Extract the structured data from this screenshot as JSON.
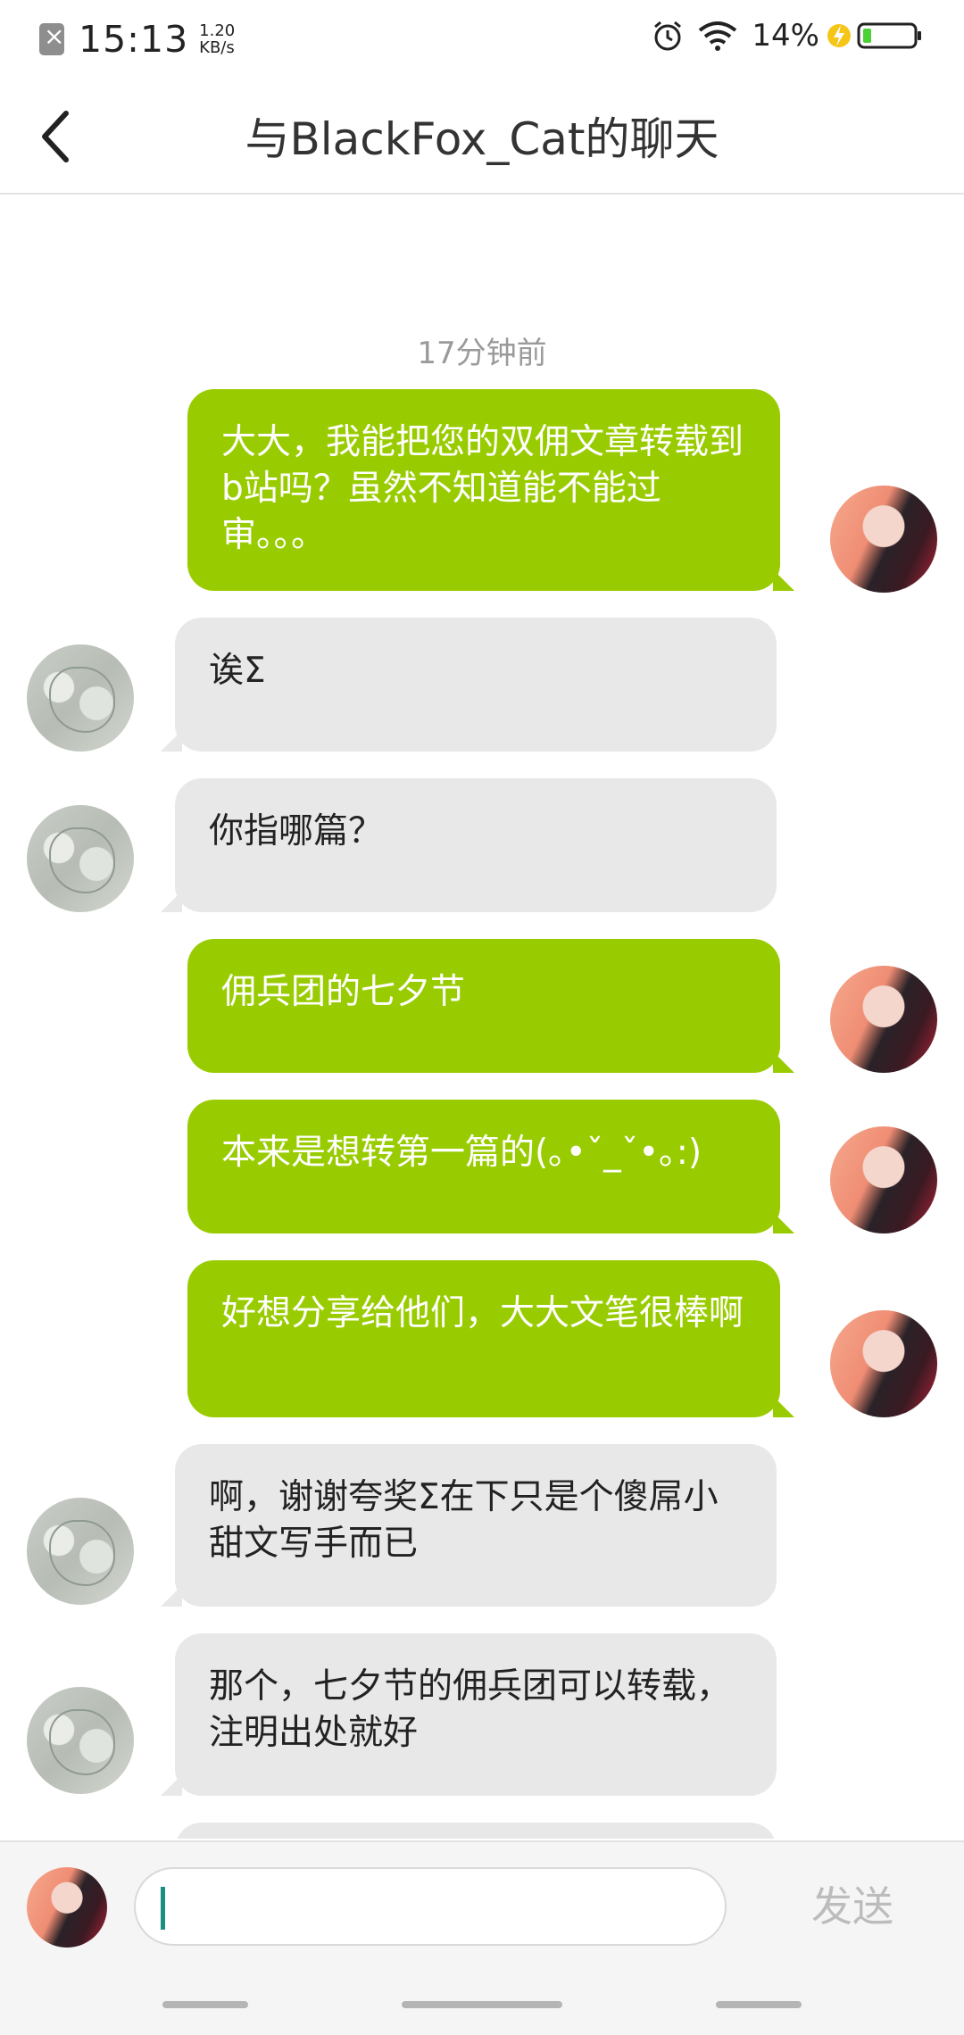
{
  "status_bar": {
    "time": "15:13",
    "speed_value": "1.20",
    "speed_unit": "KB/s",
    "battery_percent": "14%",
    "icons": [
      "sim-missing-icon",
      "alarm-icon",
      "wifi-icon",
      "charging-bolt-icon",
      "battery-icon"
    ]
  },
  "header": {
    "title": "与BlackFox_Cat的聊天",
    "back_icon": "chevron-left-icon"
  },
  "chat": {
    "timestamp": "17分钟前",
    "messages": [
      {
        "from": "me",
        "text": "大大，我能把您的双佣文章转载到b站吗？虽然不知道能不能过审。。。"
      },
      {
        "from": "other",
        "text": "诶Σ"
      },
      {
        "from": "other",
        "text": "你指哪篇？"
      },
      {
        "from": "me",
        "text": "佣兵团的七夕节"
      },
      {
        "from": "me",
        "text": "本来是想转第一篇的(｡•ˇ_ˇ•｡:)"
      },
      {
        "from": "me",
        "text": "好想分享给他们，大大文笔很棒啊"
      },
      {
        "from": "other",
        "text": "啊，谢谢夸奖Σ在下只是个傻屌小甜文写手而已"
      },
      {
        "from": "other",
        "text": "那个，七夕节的佣兵团可以转载，注明出处就好"
      }
    ]
  },
  "input_bar": {
    "text_value": "",
    "send_label": "发送"
  },
  "colors": {
    "my_bubble": "#99cc00",
    "other_bubble": "#e8e8e8",
    "caret": "#1b8f83"
  }
}
